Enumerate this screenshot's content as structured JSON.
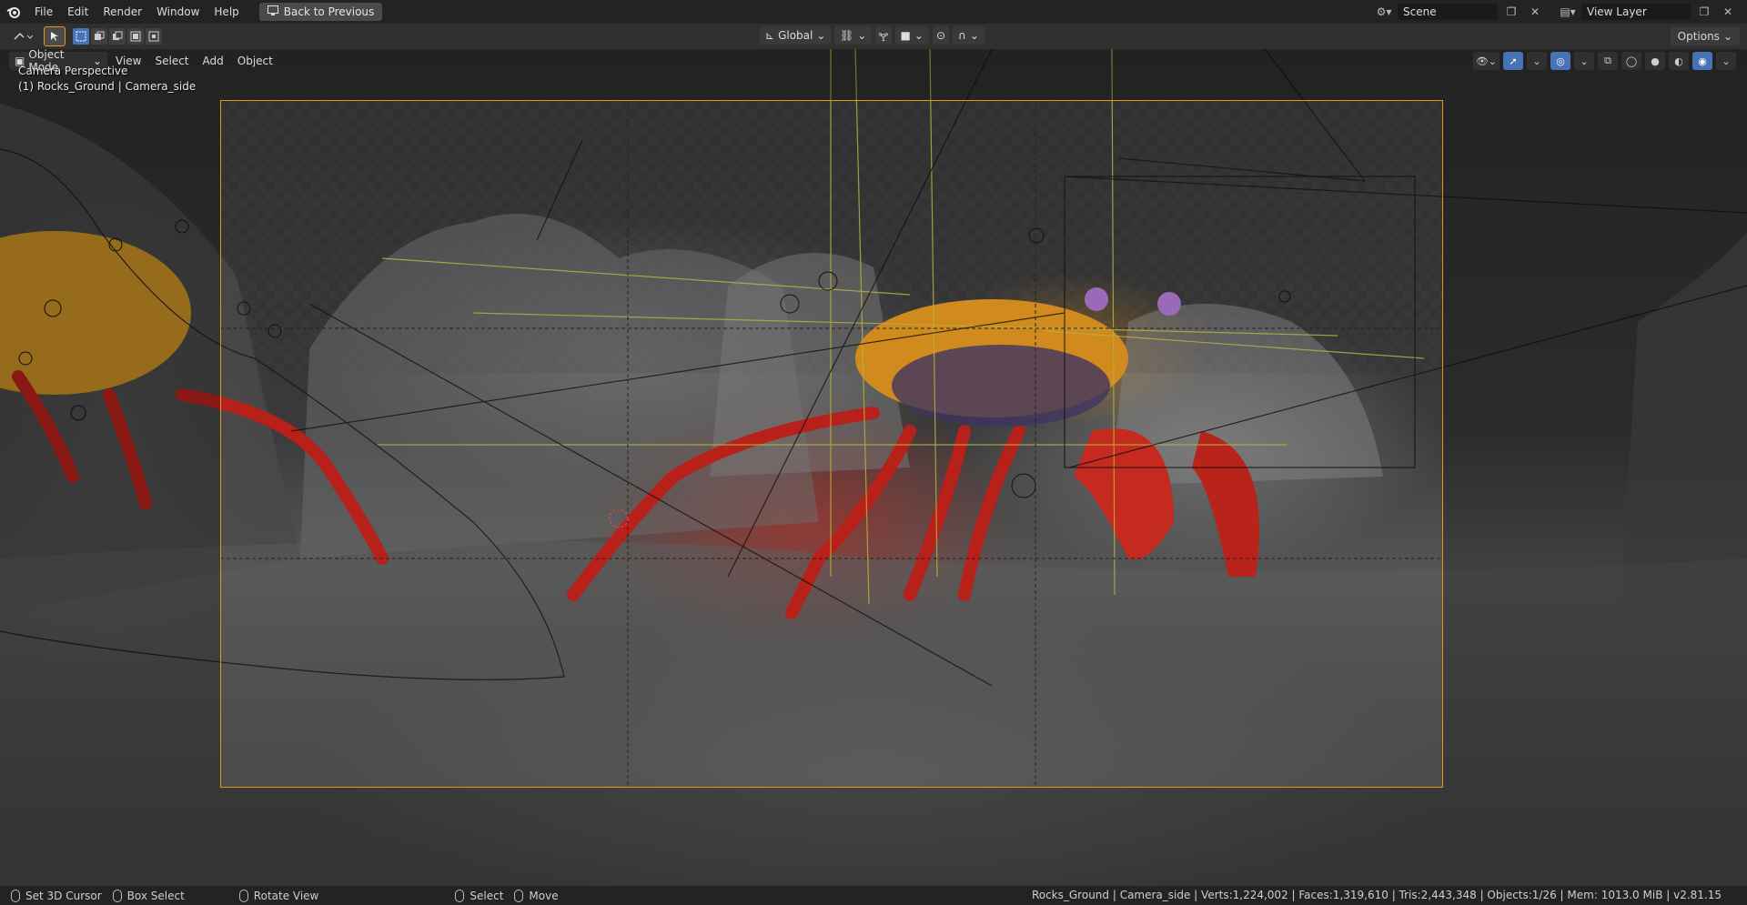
{
  "topbar": {
    "menus": [
      "File",
      "Edit",
      "Render",
      "Window",
      "Help"
    ],
    "back_label": "Back to Previous",
    "scene_name": "Scene",
    "view_layer": "View Layer"
  },
  "toolheader": {
    "orientation": "Global",
    "options_label": "Options"
  },
  "viewport": {
    "mode_label": "Object Mode",
    "menus": [
      "View",
      "Select",
      "Add",
      "Object"
    ],
    "perspective_text": "Camera Perspective",
    "object_text": "(1) Rocks_Ground | Camera_side"
  },
  "statusbar": {
    "items": [
      "Set 3D Cursor",
      "Box Select",
      "Rotate View",
      "Select",
      "Move"
    ],
    "stats": "Rocks_Ground | Camera_side | Verts:1,224,002 | Faces:1,319,610 | Tris:2,443,348 | Objects:1/26 | Mem: 1013.0 MiB | v2.81.15"
  },
  "colors": {
    "accent_blue": "#4772b3",
    "camera_frame": "#e5951f",
    "crab_red": "#c8281e",
    "crab_orange": "#e0961e"
  }
}
